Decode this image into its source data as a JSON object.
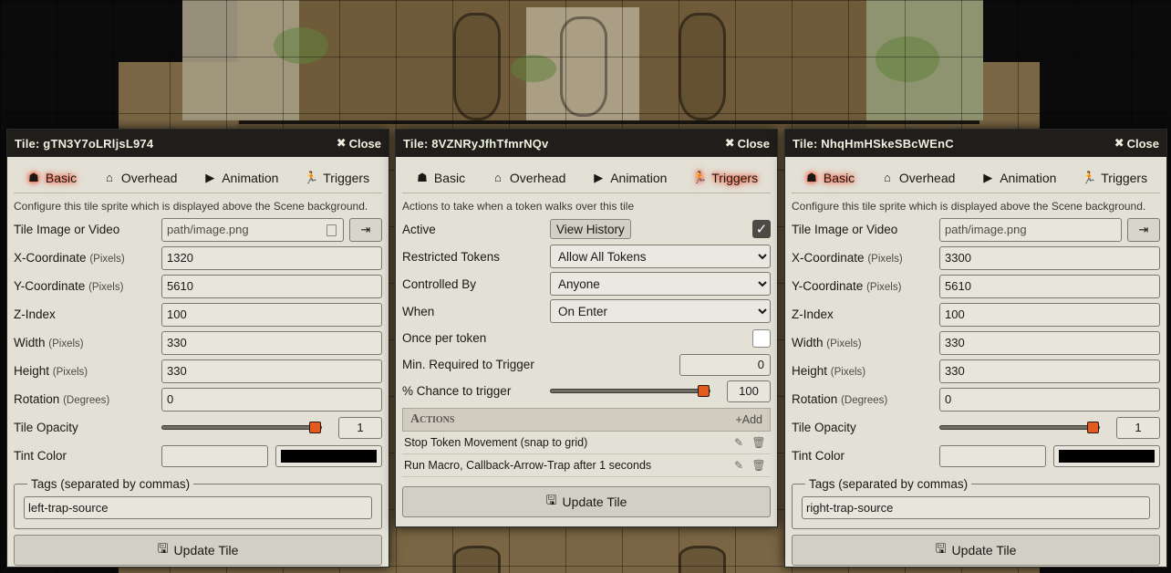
{
  "left": {
    "title": "Tile: gTN3Y7oLRljsL974",
    "close": "Close",
    "tabs": [
      "Basic",
      "Overhead",
      "Animation",
      "Triggers"
    ],
    "hint": "Configure this tile sprite which is displayed above the Scene background.",
    "image_label": "Tile Image or Video",
    "image_value": "path/image.png",
    "x_label": "X-Coordinate",
    "x_unit": "(Pixels)",
    "x_value": "1320",
    "y_label": "Y-Coordinate",
    "y_unit": "(Pixels)",
    "y_value": "5610",
    "z_label": "Z-Index",
    "z_value": "100",
    "w_label": "Width",
    "w_unit": "(Pixels)",
    "w_value": "330",
    "h_label": "Height",
    "h_unit": "(Pixels)",
    "h_value": "330",
    "rot_label": "Rotation",
    "rot_unit": "(Degrees)",
    "rot_value": "0",
    "opacity_label": "Tile Opacity",
    "opacity_value": "1",
    "opacity_level": 1,
    "tint_label": "Tint Color",
    "tags_legend": "Tags (separated by commas)",
    "tags_value": "left-trap-source",
    "update": "Update Tile"
  },
  "middle": {
    "title": "Tile: 8VZNRyJfhTfmrNQv",
    "close": "Close",
    "tabs": [
      "Basic",
      "Overhead",
      "Animation",
      "Triggers"
    ],
    "hint": "Actions to take when a token walks over this tile",
    "active_label": "Active",
    "view_history": "View History",
    "active_checked": true,
    "restricted_label": "Restricted Tokens",
    "restricted_value": "Allow All Tokens",
    "controlled_label": "Controlled By",
    "controlled_value": "Anyone",
    "when_label": "When",
    "when_value": "On Enter",
    "once_label": "Once per token",
    "once_checked": false,
    "minreq_label": "Min. Required to Trigger",
    "minreq_value": "0",
    "chance_label": "% Chance to trigger",
    "chance_value": "100",
    "chance_level": 1,
    "actions_title": "Actions",
    "actions_add": "Add",
    "actions": [
      "Stop Token Movement (snap to grid)",
      "Run Macro, Callback-Arrow-Trap after 1 seconds"
    ],
    "update": "Update Tile"
  },
  "right": {
    "title": "Tile: NhqHmHSkeSBcWEnC",
    "close": "Close",
    "tabs": [
      "Basic",
      "Overhead",
      "Animation",
      "Triggers"
    ],
    "hint": "Configure this tile sprite which is displayed above the Scene background.",
    "image_label": "Tile Image or Video",
    "image_value": "path/image.png",
    "x_label": "X-Coordinate",
    "x_unit": "(Pixels)",
    "x_value": "3300",
    "y_label": "Y-Coordinate",
    "y_unit": "(Pixels)",
    "y_value": "5610",
    "z_label": "Z-Index",
    "z_value": "100",
    "w_label": "Width",
    "w_unit": "(Pixels)",
    "w_value": "330",
    "h_label": "Height",
    "h_unit": "(Pixels)",
    "h_value": "330",
    "rot_label": "Rotation",
    "rot_unit": "(Degrees)",
    "rot_value": "0",
    "opacity_label": "Tile Opacity",
    "opacity_value": "1",
    "opacity_level": 1,
    "tint_label": "Tint Color",
    "tags_legend": "Tags (separated by commas)",
    "tags_value": "right-trap-source",
    "update": "Update Tile"
  },
  "colors": {
    "accent": "#e25a1c",
    "header": "#1f1e1b",
    "panel": "#e3e0d6",
    "active_glow": "#ff3a1a"
  },
  "icons": {
    "basic": "cubes-icon",
    "overhead": "home-icon",
    "animation": "play-icon",
    "triggers": "running-icon",
    "close": "times-icon",
    "update": "save-icon"
  }
}
